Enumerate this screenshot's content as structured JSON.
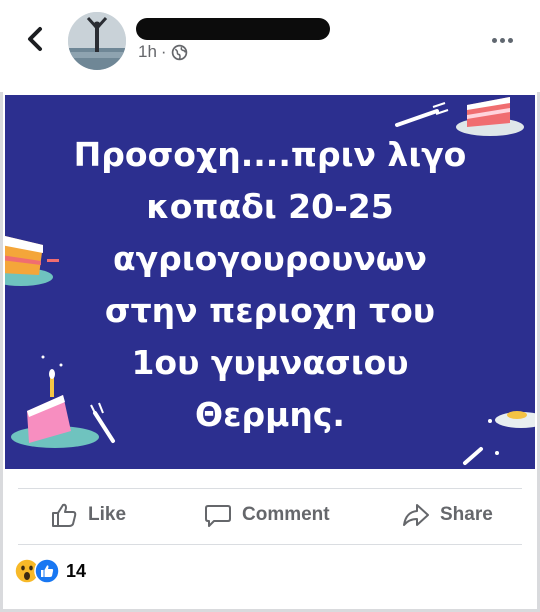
{
  "post": {
    "time": "1h",
    "privacy_icon": "globe-icon",
    "image_text": [
      "Προσοχη....πριν λιγο",
      "κοπαδι 20-25",
      "αγριογουρουνων",
      "στην περιοχη του",
      "1ου γυμνασιου",
      "Θερμης."
    ]
  },
  "actions": {
    "like": "Like",
    "comment": "Comment",
    "share": "Share"
  },
  "reactions": {
    "count": "14",
    "icons": [
      "wow-reaction-icon",
      "like-reaction-icon"
    ]
  },
  "colors": {
    "post_background": "#2c2f8f",
    "action_text": "#65676b",
    "like_blue": "#1877f2",
    "wow_yellow": "#f7b928"
  }
}
